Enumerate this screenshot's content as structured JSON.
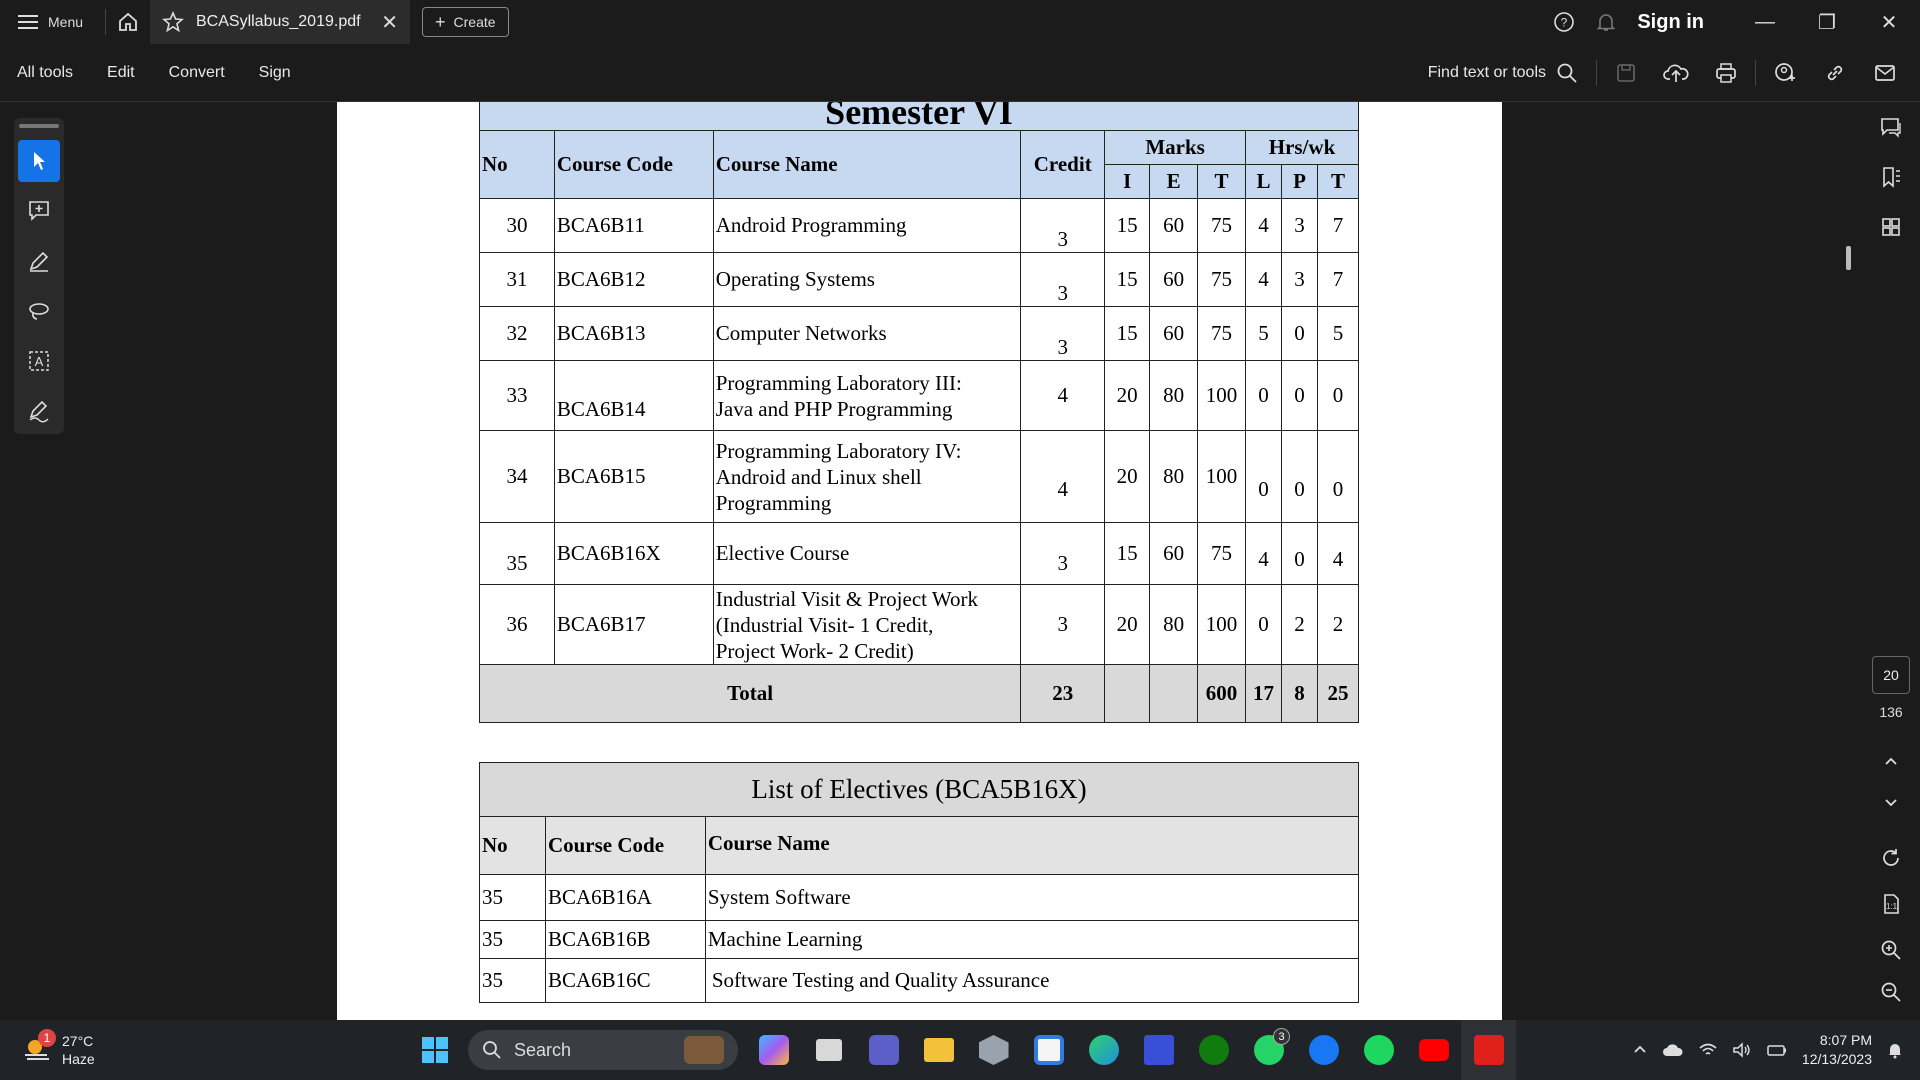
{
  "topbar": {
    "menu_label": "Menu",
    "tab_title": "BCASyllabus_2019.pdf",
    "create_label": "Create",
    "signin_label": "Sign in"
  },
  "toolbar": {
    "items": [
      "All tools",
      "Edit",
      "Convert",
      "Sign"
    ],
    "find_label": "Find text or tools"
  },
  "page_nav": {
    "current": "20",
    "total": "136"
  },
  "semester": {
    "heading": "Semester VI",
    "headers": {
      "no": "No",
      "code": "Course Code",
      "name": "Course Name",
      "credit": "Credit",
      "marks": "Marks",
      "hrs": "Hrs/wk",
      "i": "I",
      "e": "E",
      "t": "T",
      "l": "L",
      "p": "P",
      "t2": "T"
    },
    "rows": [
      {
        "no": "30",
        "code": "BCA6B11",
        "name": [
          "Android Programming"
        ],
        "credit": "3",
        "i": "15",
        "e": "60",
        "t": "75",
        "l": "4",
        "p": "3",
        "t2": "7"
      },
      {
        "no": "31",
        "code": "BCA6B12",
        "name": [
          "Operating Systems"
        ],
        "credit": "3",
        "i": "15",
        "e": "60",
        "t": "75",
        "l": "4",
        "p": "3",
        "t2": "7"
      },
      {
        "no": "32",
        "code": "BCA6B13",
        "name": [
          "Computer Networks"
        ],
        "credit": "3",
        "i": "15",
        "e": "60",
        "t": "75",
        "l": "5",
        "p": "0",
        "t2": "5"
      },
      {
        "no": "33",
        "code": "BCA6B14",
        "name": [
          "Programming Laboratory III:",
          "Java and PHP  Programming"
        ],
        "credit": "4",
        "i": "20",
        "e": "80",
        "t": "100",
        "l": "0",
        "p": "0",
        "t2": "0"
      },
      {
        "no": "34",
        "code": "BCA6B15",
        "name": [
          "Programming Laboratory IV:",
          "Android and Linux shell",
          "Programming"
        ],
        "credit": "4",
        "i": "20",
        "e": "80",
        "t": "100",
        "l": "0",
        "p": "0",
        "t2": "0"
      },
      {
        "no": "35",
        "code": "BCA6B16X",
        "name": [
          "Elective Course"
        ],
        "credit": "3",
        "i": "15",
        "e": "60",
        "t": "75",
        "l": "4",
        "p": "0",
        "t2": "4"
      },
      {
        "no": "36",
        "code": "BCA6B17",
        "name": [
          "Industrial Visit & Project Work",
          "(Industrial Visit- 1 Credit,",
          "Project Work- 2 Credit)"
        ],
        "credit": "3",
        "i": "20",
        "e": "80",
        "t": "100",
        "l": "0",
        "p": "2",
        "t2": "2"
      }
    ],
    "total": {
      "label": "Total",
      "credit": "23",
      "t": "600",
      "l": "17",
      "p": "8",
      "t2": "25"
    }
  },
  "electives": {
    "title": "List of Electives (BCA5B16X)",
    "headers": {
      "no": "No",
      "code": "Course Code",
      "name": "Course Name"
    },
    "rows": [
      {
        "no": "35",
        "code": "BCA6B16A",
        "name": "System Software"
      },
      {
        "no": "35",
        "code": "BCA6B16B",
        "name": "Machine Learning"
      },
      {
        "no": "35",
        "code": "BCA6B16C",
        "name": "Software Testing and Quality Assurance"
      }
    ]
  },
  "taskbar": {
    "weather_badge": "1",
    "temperature": "27°C",
    "condition": "Haze",
    "search_label": "Search",
    "whatsapp_badge": "3",
    "time": "8:07 PM",
    "date": "12/13/2023"
  }
}
